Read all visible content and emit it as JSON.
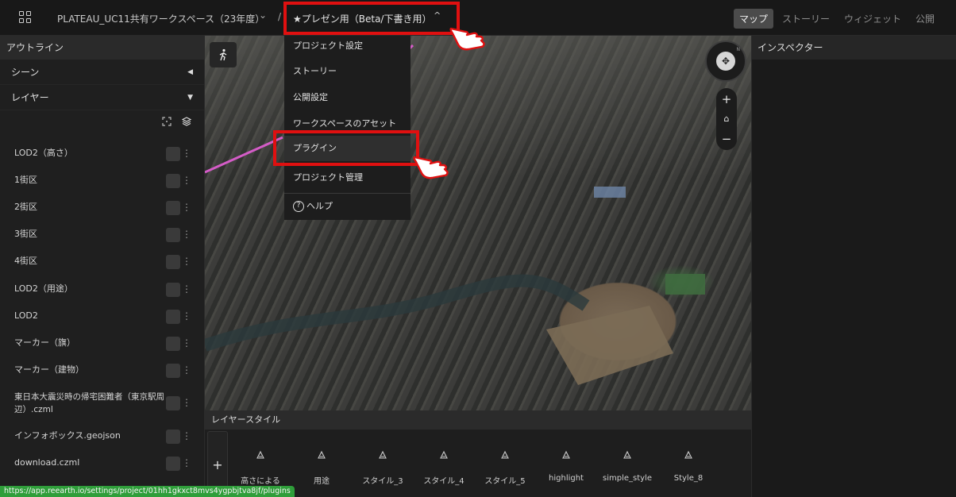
{
  "header": {
    "workspace_name": "PLATEAU_UC11共有ワークスペース（23年度）",
    "workspace_chevron": "⌄",
    "separator": "/",
    "project_name": "★プレゼン用（Beta/下書き用）",
    "project_chevron": "^",
    "tabs": [
      "マップ",
      "ストーリー",
      "ウィジェット",
      "公開"
    ],
    "active_tab": "マップ"
  },
  "outline": {
    "title": "アウトライン",
    "scene_label": "シーン",
    "layers_label": "レイヤー",
    "layers": [
      "LOD2（高さ）",
      "1街区",
      "2街区",
      "3街区",
      "4街区",
      "LOD2（用途）",
      "LOD2",
      "マーカー（旗）",
      "マーカー（建物）",
      "東日本大震災時の帰宅困難者（東京駅周辺）.czml",
      "インフォボックス.geojson",
      "download.czml"
    ]
  },
  "menu": {
    "items": [
      "プロジェクト設定",
      "ストーリー",
      "公開設定",
      "ワークスペースのアセット",
      "プラグイン",
      "プロジェクト管理"
    ],
    "help_label": "ヘルプ",
    "highlighted_item": "プラグイン"
  },
  "map_controls": {
    "zoom_in": "+",
    "home": "⌂",
    "zoom_out": "−",
    "compass_north": "N"
  },
  "inspector": {
    "title": "インスペクター"
  },
  "layer_style": {
    "title": "レイヤースタイル",
    "add_label": "+",
    "styles": [
      "高さによる",
      "用途",
      "スタイル_3",
      "スタイル_4",
      "スタイル_5",
      "highlight",
      "simple_style",
      "Style_8"
    ]
  },
  "status_url": "https://app.reearth.io/settings/project/01hh1gkxct8mvs4ygpbjtva8jf/plugins",
  "colors": {
    "highlight_box": "#e01010",
    "status_bar": "#2f9e3a",
    "route_line": "#d45cc7"
  },
  "icons": [
    "grid-icon",
    "pedestrian-icon",
    "compass-icon",
    "home-icon",
    "help-icon",
    "layers-icon",
    "select-icon",
    "style-icon",
    "hand-pointer-icon"
  ]
}
